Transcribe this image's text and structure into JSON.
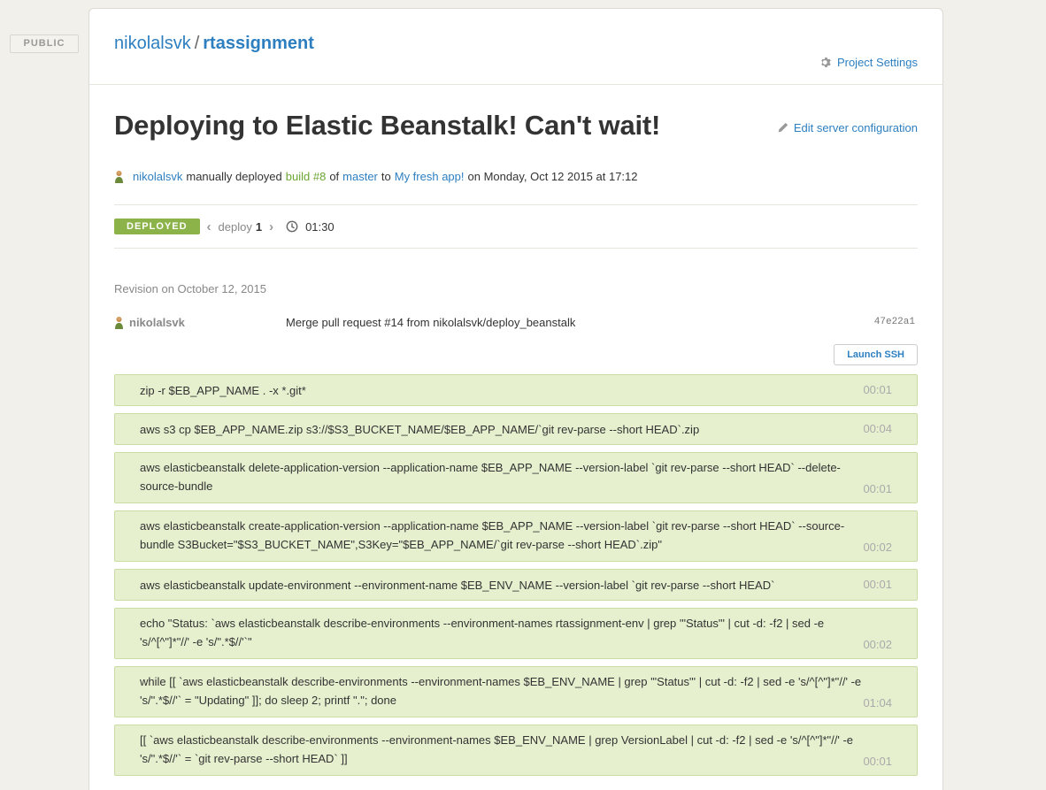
{
  "public_badge": "PUBLIC",
  "header": {
    "owner": "nikolalsvk",
    "separator": "/",
    "repo": "rtassignment",
    "settings_label": "Project Settings"
  },
  "title": "Deploying to Elastic Beanstalk! Can't wait!",
  "edit_config_label": "Edit server configuration",
  "meta": {
    "user": "nikolalsvk",
    "text1": "manually deployed",
    "build": "build #8",
    "text2": "of",
    "branch": "master",
    "text3": "to",
    "app": "My fresh app!",
    "text4": "on Monday, Oct 12 2015 at 17:12"
  },
  "status": {
    "badge": "DEPLOYED",
    "deploy_label": "deploy",
    "deploy_num": "1",
    "duration": "01:30"
  },
  "revision": {
    "label": "Revision on October 12, 2015",
    "author": "nikolalsvk",
    "message": "Merge pull request #14 from nikolalsvk/deploy_beanstalk",
    "sha": "47e22a1"
  },
  "ssh_button": "Launch SSH",
  "steps": [
    {
      "cmd": "zip -r $EB_APP_NAME . -x *.git*",
      "time": "00:01"
    },
    {
      "cmd": "aws s3 cp $EB_APP_NAME.zip s3://$S3_BUCKET_NAME/$EB_APP_NAME/`git rev-parse --short HEAD`.zip",
      "time": "00:04"
    },
    {
      "cmd": "aws elasticbeanstalk delete-application-version --application-name $EB_APP_NAME --version-label `git rev-parse --short HEAD` --delete-source-bundle",
      "time": "00:01"
    },
    {
      "cmd": "aws elasticbeanstalk create-application-version --application-name $EB_APP_NAME --version-label `git rev-parse --short HEAD` --source-bundle S3Bucket=\"$S3_BUCKET_NAME\",S3Key=\"$EB_APP_NAME/`git rev-parse --short HEAD`.zip\"",
      "time": "00:02"
    },
    {
      "cmd": "aws elasticbeanstalk update-environment --environment-name $EB_ENV_NAME --version-label `git rev-parse --short HEAD`",
      "time": "00:01"
    },
    {
      "cmd": "echo \"Status: `aws elasticbeanstalk describe-environments --environment-names rtassignment-env | grep '\"Status\"' | cut -d: -f2 | sed -e 's/^[^\"]*\"//' -e 's/\".*$//'`\"",
      "time": "00:02"
    },
    {
      "cmd": "while [[ `aws elasticbeanstalk describe-environments --environment-names $EB_ENV_NAME | grep '\"Status\"' | cut -d: -f2 | sed -e 's/^[^\"]*\"//' -e 's/\".*$//'` = \"Updating\" ]]; do sleep 2; printf \".\"; done",
      "time": "01:04"
    },
    {
      "cmd": "[[ `aws elasticbeanstalk describe-environments --environment-names $EB_ENV_NAME | grep VersionLabel | cut -d: -f2 | sed -e 's/^[^\"]*\"//' -e 's/\".*$//'` = `git rev-parse --short HEAD` ]]",
      "time": "00:01"
    }
  ]
}
